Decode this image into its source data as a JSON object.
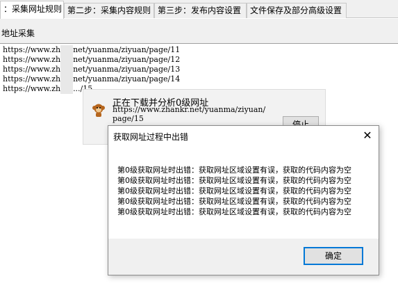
{
  "tabs": [
    {
      "label": "：采集网址规则"
    },
    {
      "label": "第二步：采集内容规则"
    },
    {
      "label": "第三步：发布内容设置"
    },
    {
      "label": "文件保存及部分高级设置"
    }
  ],
  "section": {
    "title": "地址采集"
  },
  "url_list": [
    {
      "prefix": "https://www.zh",
      "suffix": "net/yuanma/ziyuan/page/11"
    },
    {
      "prefix": "https://www.zh",
      "suffix": "net/yuanma/ziyuan/page/12"
    },
    {
      "prefix": "https://www.zh",
      "suffix": "net/yuanma/ziyuan/page/13"
    },
    {
      "prefix": "https://www.zh",
      "suffix": "net/yuanma/ziyuan/page/14"
    },
    {
      "prefix": "https://www.zh",
      "suffix": ".../15"
    }
  ],
  "progress": {
    "title": "正在下载并分析0级网址",
    "url_line1": "https://www.zhankr.net/yuanma/ziyuan/",
    "url_line2": "page/15",
    "stop_label": "停止"
  },
  "error_dialog": {
    "title": "获取网址过程中出错",
    "close_glyph": "✕",
    "lines": [
      "第0级获取网址时出错：获取网址区域设置有误，获取的代码内容为空",
      "第0级获取网址时出错：获取网址区域设置有误，获取的代码内容为空",
      "第0级获取网址时出错：获取网址区域设置有误，获取的代码内容为空",
      "第0级获取网址时出错：获取网址区域设置有误，获取的代码内容为空",
      "第0级获取网址时出错：获取网址区域设置有误，获取的代码内容为空"
    ],
    "ok_label": "确定"
  },
  "icons": {
    "progress_icon": "monkey-icon",
    "close_icon": "close-icon"
  },
  "colors": {
    "accent": "#0078d7",
    "chrome": "#f0f0f0"
  }
}
